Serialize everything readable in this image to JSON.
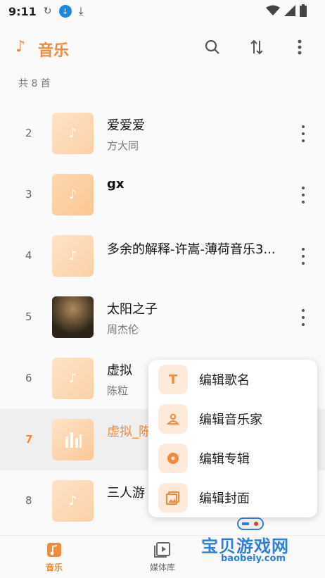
{
  "status": {
    "time": "9:11"
  },
  "header": {
    "title": "音乐",
    "icons": [
      "music-note-icon",
      "search-icon",
      "sort-icon",
      "more-icon"
    ]
  },
  "list": {
    "count_text": "共 8 首",
    "songs": [
      {
        "num": "2",
        "title": "爱爱爱",
        "artist": "方大同"
      },
      {
        "num": "3",
        "title": "gx",
        "artist": ""
      },
      {
        "num": "4",
        "title": "多余的解释-许嵩-薄荷音乐3...",
        "artist": ""
      },
      {
        "num": "5",
        "title": "太阳之子",
        "artist": "周杰伦"
      },
      {
        "num": "6",
        "title": "虚拟",
        "artist": "陈粒"
      },
      {
        "num": "7",
        "title": "虚拟_陈",
        "artist": ""
      },
      {
        "num": "8",
        "title": "三人游",
        "artist": ""
      }
    ]
  },
  "popup": {
    "items": [
      {
        "label": "编辑歌名",
        "icon": "text-icon"
      },
      {
        "label": "编辑音乐家",
        "icon": "person-icon"
      },
      {
        "label": "编辑专辑",
        "icon": "album-icon"
      },
      {
        "label": "编辑封面",
        "icon": "image-icon"
      }
    ]
  },
  "nav": {
    "items": [
      {
        "label": "音乐",
        "icon": "music-icon"
      },
      {
        "label": "媒体库",
        "icon": "library-icon"
      }
    ]
  },
  "watermark": {
    "text": "宝贝游戏网",
    "sub": "baobeiy.com"
  },
  "colors": {
    "accent": "#f08a3c",
    "popup_icon_bg": "#fdeadb"
  }
}
